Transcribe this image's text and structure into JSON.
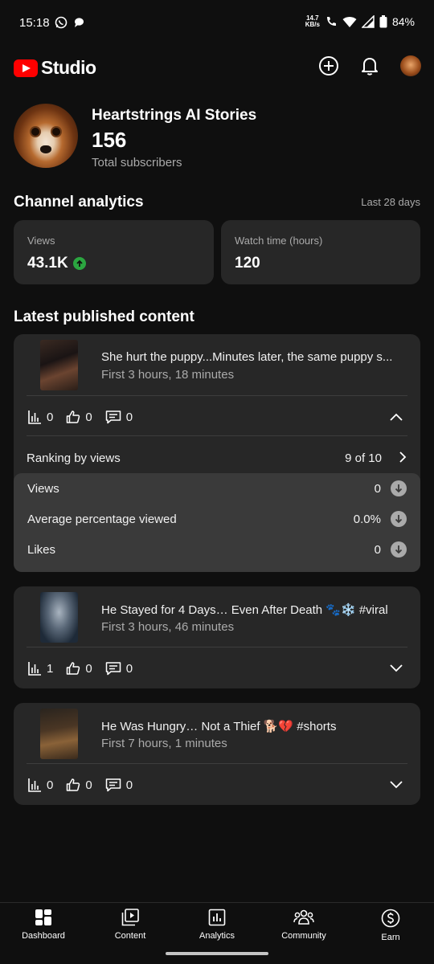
{
  "status_bar": {
    "time": "15:18",
    "speed_value": "14.7",
    "speed_unit": "KB/s",
    "battery": "84%"
  },
  "app": {
    "logo_text": "Studio",
    "icons": [
      "create-icon",
      "notifications-icon",
      "account-avatar"
    ]
  },
  "channel": {
    "name": "Heartstrings AI Stories",
    "subscribers": "156",
    "subscribers_label": "Total subscribers"
  },
  "analytics": {
    "title": "Channel analytics",
    "period": "Last 28 days",
    "views_label": "Views",
    "views_value": "43.1K",
    "watch_label": "Watch time (hours)",
    "watch_value": "120"
  },
  "latest": {
    "title": "Latest published content",
    "videos": [
      {
        "title": "She hurt the puppy...Minutes later, the same puppy s...",
        "meta": "First 3 hours, 18 minutes",
        "views": "0",
        "likes": "0",
        "comments": "0",
        "expanded": true,
        "ranking_label": "Ranking by views",
        "ranking_value": "9 of 10",
        "details": [
          {
            "label": "Views",
            "value": "0"
          },
          {
            "label": "Average percentage viewed",
            "value": "0.0%"
          },
          {
            "label": "Likes",
            "value": "0"
          }
        ]
      },
      {
        "title": "He Stayed for 4 Days… Even After Death 🐾❄️ #viral",
        "meta": "First 3 hours, 46 minutes",
        "views": "1",
        "likes": "0",
        "comments": "0",
        "expanded": false
      },
      {
        "title": "He Was Hungry… Not a Thief 🐕💔 #shorts",
        "meta": "First 7 hours, 1 minutes",
        "views": "0",
        "likes": "0",
        "comments": "0",
        "expanded": false
      }
    ]
  },
  "nav": {
    "items": [
      {
        "label": "Dashboard",
        "icon": "dashboard-icon"
      },
      {
        "label": "Content",
        "icon": "content-icon"
      },
      {
        "label": "Analytics",
        "icon": "analytics-icon"
      },
      {
        "label": "Community",
        "icon": "community-icon"
      },
      {
        "label": "Earn",
        "icon": "earn-icon"
      }
    ]
  }
}
